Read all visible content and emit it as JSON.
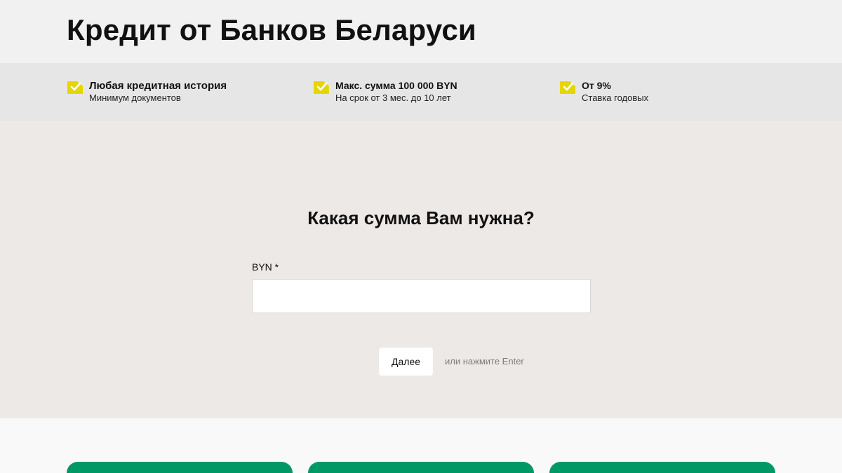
{
  "header": {
    "title": "Кредит от Банков Беларуси"
  },
  "features": [
    {
      "icon": "checkmark-note-icon",
      "title": "Любая кредитная история",
      "subtitle": "Минимум документов"
    },
    {
      "icon": "checkmark-note-icon",
      "title": "Макс. сумма 100 000 BYN",
      "subtitle": "На срок от 3 мес. до 10 лет"
    },
    {
      "icon": "checkmark-note-icon",
      "title": "От 9%",
      "subtitle": "Ставка годовых"
    }
  ],
  "form": {
    "question": "Какая сумма Вам нужна?",
    "amount_label": "BYN *",
    "amount_value": "",
    "amount_placeholder": "",
    "next_label": "Далее",
    "enter_hint": "или нажмите Enter"
  },
  "colors": {
    "accent_yellow": "#e6d600",
    "card_green": "#009966",
    "form_bg": "#ede9e6",
    "features_bg": "#e6e6e6"
  }
}
